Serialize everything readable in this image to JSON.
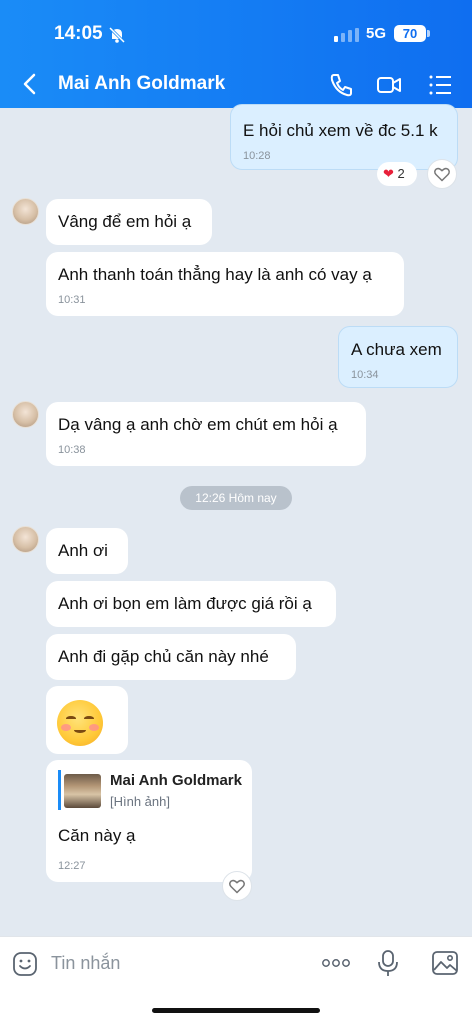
{
  "status": {
    "time": "14:05",
    "network": "5G",
    "battery": "70"
  },
  "header": {
    "title": "Mai Anh Goldmark"
  },
  "messages": {
    "m1": {
      "text": "E hỏi chủ xem về đc 5.1 k",
      "time": "10:28",
      "reaction_count": "2"
    },
    "m2": {
      "text": "Vâng để em hỏi ạ"
    },
    "m3": {
      "text": "Anh thanh toán thẳng hay là anh có vay ạ",
      "time": "10:31"
    },
    "m4": {
      "text": "A chưa xem",
      "time": "10:34"
    },
    "m5": {
      "text": "Dạ vâng ạ anh chờ em chút em hỏi ạ",
      "time": "10:38"
    },
    "divider": "12:26 Hôm nay",
    "m6": {
      "text": "Anh ơi"
    },
    "m7": {
      "text": "Anh ơi bọn em làm được giá rồi ạ"
    },
    "m8": {
      "text": "Anh đi gặp chủ căn này nhé"
    },
    "m10": {
      "reply_name": "Mai Anh Goldmark",
      "reply_type": "[Hình ảnh]",
      "text": "Căn này ạ",
      "time": "12:27"
    }
  },
  "input": {
    "placeholder": "Tin nhắn"
  },
  "colors": {
    "header": "#1a8cf7",
    "my_bubble": "#dbefff",
    "chat_bg": "#e2e9f1"
  }
}
